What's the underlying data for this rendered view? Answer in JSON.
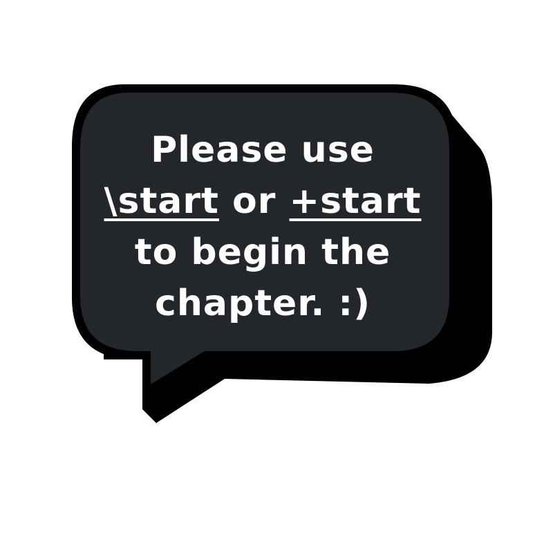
{
  "colors": {
    "bubble_fill": "#23262b",
    "bubble_outline": "#000000",
    "shadow": "#000000",
    "text": "#ffffff",
    "background": "#ffffff"
  },
  "message": {
    "line1": "Please use",
    "command1": "\\start",
    "connector": "or",
    "command2": "+start",
    "line3": "to begin the",
    "line4": "chapter. :)"
  }
}
